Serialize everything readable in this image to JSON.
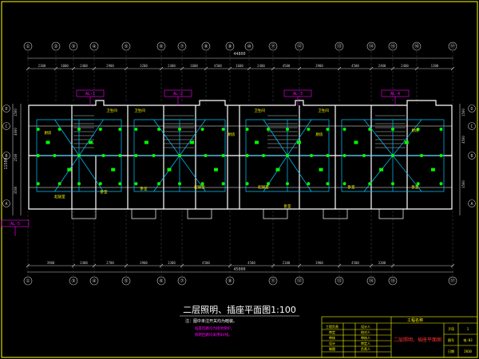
{
  "drawing": {
    "title": "二层照明、插座平面图1:100",
    "note_line1": "注：图中未注开关均为暗装。",
    "note_line2": "插座回路均为接地保护。",
    "note_line3": "照明回路均采用BV线。",
    "overall_top": "44800",
    "overall_bottom": "45000",
    "overall_side": "11500"
  },
  "grid": {
    "top_labels": [
      "①",
      "②",
      "③",
      "④",
      "⑤",
      "⑥",
      "⑦",
      "⑧",
      "⑨",
      "⑩",
      "⑪",
      "⑫",
      "⑬",
      "⑭",
      "⑮",
      "⑯",
      "⑰"
    ],
    "bottom_labels": [
      "①",
      "③",
      "④",
      "⑤",
      "⑥",
      "⑦",
      "⑨",
      "⑪",
      "⑫",
      "⑬",
      "⑭",
      "⑮",
      "⑰"
    ],
    "left_labels": [
      "D",
      "C",
      "B",
      "A"
    ],
    "right_labels": [
      "D",
      "C",
      "B",
      "A"
    ]
  },
  "dimensions": {
    "top_row": [
      "2300",
      "1000",
      "2400",
      "2900",
      "3200",
      "2400",
      "1600",
      "4500",
      "1600",
      "2400",
      "4500",
      "3900",
      "4500",
      "2400",
      "2400",
      "1300"
    ],
    "bottom_row": [
      "3900",
      "2400",
      "2700",
      "3900",
      "3300",
      "4500",
      "4500",
      "2100",
      "3900",
      "4500",
      "3300"
    ],
    "left_col": [
      "1500",
      "4000",
      "2500",
      "3500"
    ],
    "right_col": [
      "1500",
      "4500",
      "3500"
    ]
  },
  "rooms": {
    "bedroom": "卧室",
    "living": "起居室",
    "kitchen": "厨房",
    "bath": "卫生间"
  },
  "panel_tags": [
    "AL-1",
    "AL-2",
    "AL-3",
    "AL-4",
    "AL-5"
  ],
  "title_block": {
    "company": "工程名称",
    "drawing_name": "二层照明、插座平面图",
    "rows": [
      "工程负责",
      "审定",
      "审核",
      "设计",
      "制图"
    ],
    "signers": [
      "设计人",
      "校对人",
      "审核人",
      "审定人",
      "负责人"
    ],
    "fields": [
      "子项",
      "图号",
      "日期"
    ],
    "field_values": [
      "1",
      "电-03",
      "2010"
    ]
  },
  "colors": {
    "background": "#000000",
    "wall": "#ffffff",
    "axis": "#c8c8c8",
    "wiring": "#00c8ff",
    "fixture": "#00ff00",
    "tag": "#ff00ff",
    "label": "#ffff00",
    "title_block": "#ffff00"
  }
}
